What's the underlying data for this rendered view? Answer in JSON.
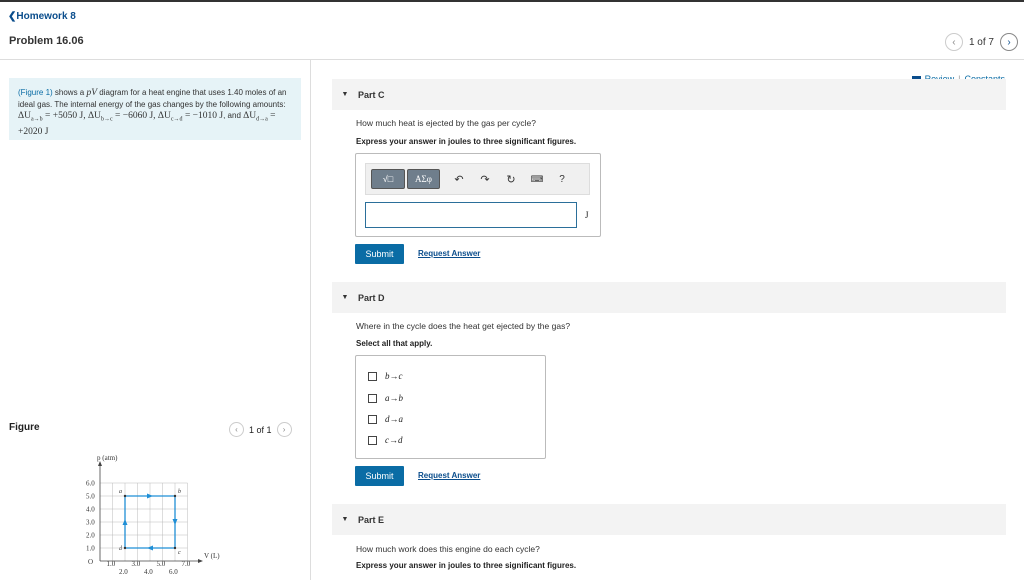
{
  "nav": {
    "back_label": "Homework 8",
    "title": "Problem 16.06",
    "pager": "1 of 7"
  },
  "links": {
    "review": "Review",
    "constants": "Constants",
    "separator": "|"
  },
  "intro": {
    "figure_link": "(Figure 1)",
    "text1": " shows a ",
    "pv": "pV",
    "text2": " diagram for a heat engine that uses 1.40 moles of an ideal gas. The internal energy of the gas changes by the following amounts: ",
    "du_ab": "ΔU",
    "sub_ab": "a→b",
    "val_ab": " = +5050 J",
    "du_bc": ", ΔU",
    "sub_bc": "b→c",
    "val_bc": " = −6060 J",
    "du_cd": ", ΔU",
    "sub_cd": "c→d",
    "val_cd": " = −1010 J",
    "and": ", and ",
    "du_da": "ΔU",
    "sub_da": "d→a",
    "val_da": " = +2020 J"
  },
  "figure": {
    "label": "Figure",
    "pager": "1 of 1",
    "y_axis_label": "p (atm)",
    "x_axis_label": "V (L)",
    "y_ticks": [
      "6.0",
      "5.0",
      "4.0",
      "3.0",
      "2.0",
      "1.0"
    ],
    "x_ticks_top": [
      "1.0",
      "3.0",
      "5.0",
      "7.0"
    ],
    "x_ticks_bottom": [
      "2.0",
      "4.0",
      "6.0"
    ],
    "origin": "O",
    "points": {
      "a": "a",
      "b": "b",
      "c": "c",
      "d": "d"
    },
    "cycle": [
      {
        "point": "a",
        "V": 2.0,
        "p": 5.0
      },
      {
        "point": "b",
        "V": 6.0,
        "p": 5.0
      },
      {
        "point": "c",
        "V": 6.0,
        "p": 1.0
      },
      {
        "point": "d",
        "V": 2.0,
        "p": 1.0
      }
    ],
    "colors": {
      "path": "#1f8fd6",
      "axes": "#444"
    }
  },
  "partC": {
    "header": "Part C",
    "question": "How much heat is ejected by the gas per cycle?",
    "instruction": "Express your answer in joules to three significant figures.",
    "toolbar": {
      "templates": "√□",
      "greek": "ΑΣφ",
      "help": "?"
    },
    "answer_value": "",
    "unit": "J",
    "submit": "Submit",
    "request": "Request Answer"
  },
  "partD": {
    "header": "Part D",
    "question": "Where in the cycle does the heat get ejected by the gas?",
    "instruction": "Select all that apply.",
    "options": [
      "b→c",
      "a→b",
      "d→a",
      "c→d"
    ],
    "submit": "Submit",
    "request": "Request Answer"
  },
  "partE": {
    "header": "Part E",
    "question": "How much work does this engine do each cycle?",
    "instruction": "Express your answer in joules to three significant figures."
  }
}
